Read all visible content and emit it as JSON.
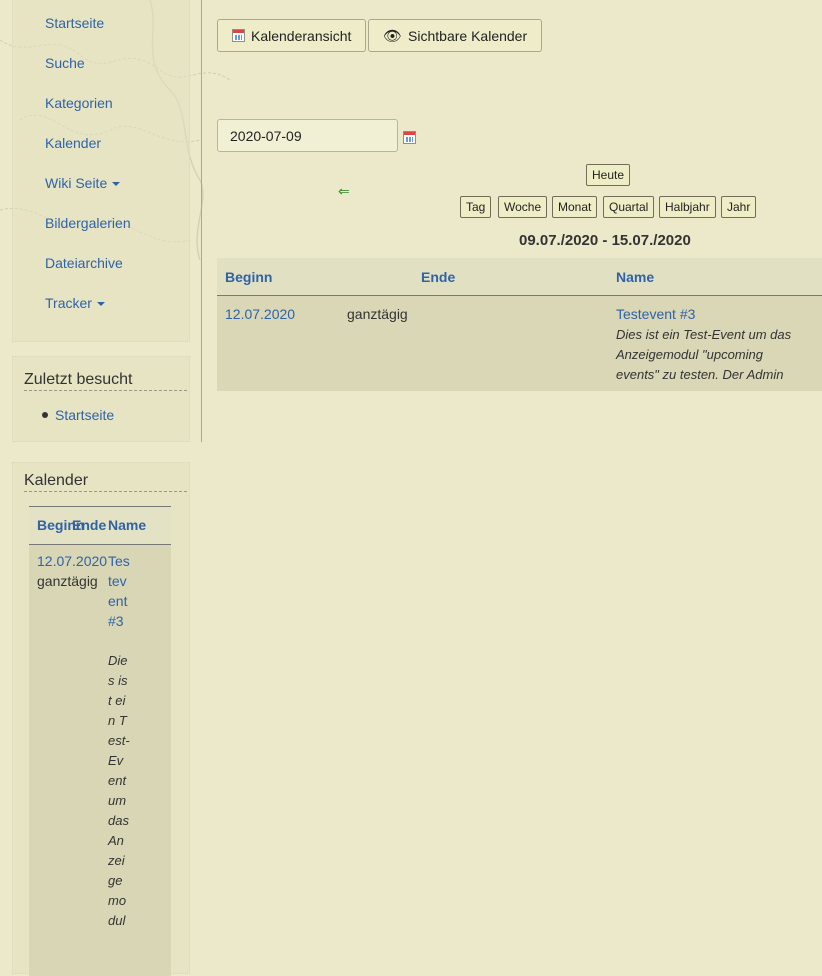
{
  "nav": {
    "items": [
      {
        "label": "Startseite"
      },
      {
        "label": "Suche"
      },
      {
        "label": "Kategorien"
      },
      {
        "label": "Kalender"
      },
      {
        "label": "Wiki Seite"
      },
      {
        "label": "Bildergalerien"
      },
      {
        "label": "Dateiarchive"
      },
      {
        "label": "Tracker"
      }
    ]
  },
  "recent": {
    "title": "Zuletzt besucht",
    "items": [
      {
        "label": "Startseite"
      }
    ]
  },
  "side_calendar": {
    "title": "Kalender",
    "headers": {
      "begin": "Beginn",
      "end": "Ende",
      "name": "Name"
    },
    "event": {
      "date": "12.07.2020",
      "allday": "ganztägig",
      "name": "Testevent #3",
      "description": "Dies ist ein Test-Event um das Anzeigemodul"
    }
  },
  "toolbar": {
    "calendar_view": "Kalenderansicht",
    "visible_calendars": "Sichtbare Kalender"
  },
  "date_field": {
    "value": "2020-07-09"
  },
  "nav_arrow": "⇐",
  "period": {
    "today": "Heute",
    "day": "Tag",
    "week": "Woche",
    "month": "Monat",
    "quarter": "Quartal",
    "halfyear": "Halbjahr",
    "year": "Jahr"
  },
  "range_title": "09.07./2020 - 15.07./2020",
  "table": {
    "headers": {
      "begin": "Beginn",
      "end": "Ende",
      "name": "Name"
    },
    "rows": [
      {
        "date": "12.07.2020",
        "allday": "ganztägig",
        "name": "Testevent #3",
        "description": "Dies ist ein Test-Event um das Anzeigemodul \"upcoming events\" zu testen. Der Admin"
      }
    ]
  }
}
